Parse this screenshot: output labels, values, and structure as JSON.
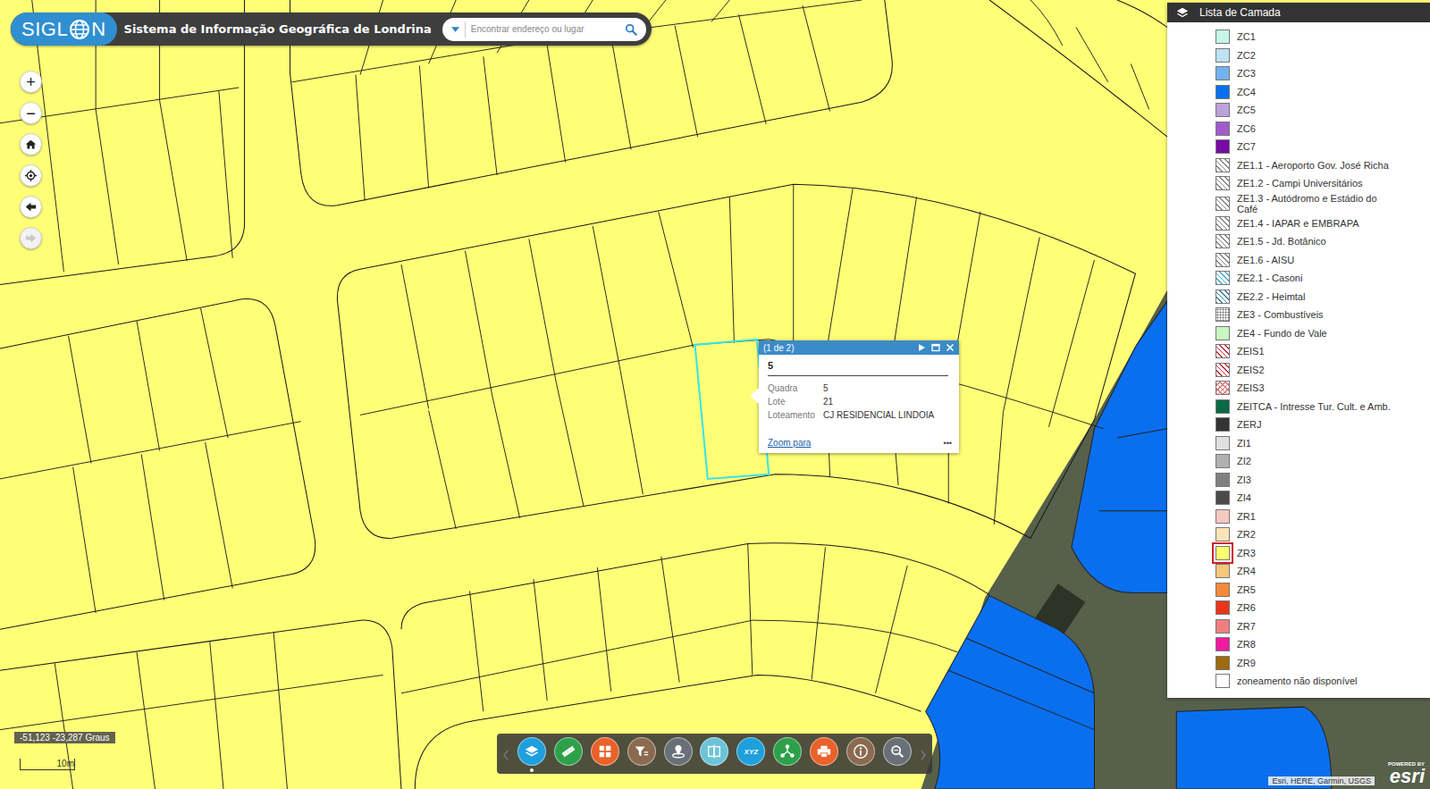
{
  "header": {
    "logo_left": "SIGL",
    "logo_right": "N",
    "title": "Sistema de Informação Geográfica de Londrina"
  },
  "search": {
    "placeholder": "Encontrar endereço ou lugar"
  },
  "map_controls": [
    {
      "kind": "zoom-in",
      "label": "+",
      "disabled": false
    },
    {
      "kind": "zoom-out",
      "label": "−",
      "disabled": false
    },
    {
      "kind": "home",
      "disabled": false
    },
    {
      "kind": "locate",
      "disabled": false
    },
    {
      "kind": "back",
      "disabled": false
    },
    {
      "kind": "forward",
      "disabled": true
    }
  ],
  "popup": {
    "counter": "(1 de 2)",
    "title": "5",
    "fields": [
      {
        "label": "Quadra",
        "value": "5"
      },
      {
        "label": "Lote",
        "value": "21"
      },
      {
        "label": "Loteamento",
        "value": "CJ RESIDENCIAL LINDOIA"
      }
    ],
    "zoom_link": "Zoom para",
    "more": "•••"
  },
  "layer_panel": {
    "title": "Lista de Camada",
    "items": [
      {
        "name": "ZC1",
        "color": "#c4f7e8",
        "kind": "solid",
        "selected": false
      },
      {
        "name": "ZC2",
        "color": "#bfe2f6",
        "kind": "solid",
        "selected": false
      },
      {
        "name": "ZC3",
        "color": "#74b2ee",
        "kind": "solid",
        "selected": false
      },
      {
        "name": "ZC4",
        "color": "#0a6fef",
        "kind": "solid",
        "selected": false
      },
      {
        "name": "ZC5",
        "color": "#bba2d9",
        "kind": "solid",
        "selected": false
      },
      {
        "name": "ZC6",
        "color": "#a15ccc",
        "kind": "solid",
        "selected": false
      },
      {
        "name": "ZC7",
        "color": "#780aa6",
        "kind": "solid",
        "selected": false
      },
      {
        "name": "ZE1.1 - Aeroporto Gov. José Richa",
        "color": "#888888",
        "kind": "hatch",
        "selected": false
      },
      {
        "name": "ZE1.2 - Campi Universitários",
        "color": "#888888",
        "kind": "hatch",
        "selected": false
      },
      {
        "name": "ZE1.3 - Autódromo e Estádio do Café",
        "color": "#888888",
        "kind": "hatch",
        "selected": false
      },
      {
        "name": "ZE1.4 - IAPAR e EMBRAPA",
        "color": "#888888",
        "kind": "hatch",
        "selected": false
      },
      {
        "name": "ZE1.5 - Jd. Botânico",
        "color": "#888888",
        "kind": "hatch",
        "selected": false
      },
      {
        "name": "ZE1.6 - AISU",
        "color": "#888888",
        "kind": "hatch",
        "selected": false
      },
      {
        "name": "ZE2.1 - Casoni",
        "color": "#4aa8c8",
        "kind": "hatch",
        "selected": false
      },
      {
        "name": "ZE2.2 - Heimtal",
        "color": "#3a7fa0",
        "kind": "hatch",
        "selected": false
      },
      {
        "name": "ZE3 - Combustíveis",
        "color": "#666666",
        "kind": "dots",
        "selected": false
      },
      {
        "name": "ZE4 - Fundo de Vale",
        "color": "#c9f5c0",
        "kind": "solid",
        "selected": false
      },
      {
        "name": "ZEIS1",
        "color": "#c0303a",
        "kind": "hatch",
        "selected": false
      },
      {
        "name": "ZEIS2",
        "color": "#c0303a",
        "kind": "hatch",
        "selected": false
      },
      {
        "name": "ZEIS3",
        "color": "#d77a7a",
        "kind": "cross",
        "selected": false
      },
      {
        "name": "ZEITCA - Intresse Tur. Cult. e Amb.",
        "color": "#0b6a46",
        "kind": "solid",
        "selected": false
      },
      {
        "name": "ZERJ",
        "color": "#333333",
        "kind": "solid",
        "selected": false
      },
      {
        "name": "ZI1",
        "color": "#e0e0e0",
        "kind": "solid",
        "selected": false
      },
      {
        "name": "ZI2",
        "color": "#b0b0b0",
        "kind": "solid",
        "selected": false
      },
      {
        "name": "ZI3",
        "color": "#808080",
        "kind": "solid",
        "selected": false
      },
      {
        "name": "ZI4",
        "color": "#4a4a4a",
        "kind": "solid",
        "selected": false
      },
      {
        "name": "ZR1",
        "color": "#f7c8c0",
        "kind": "solid",
        "selected": false
      },
      {
        "name": "ZR2",
        "color": "#fde4b8",
        "kind": "solid",
        "selected": false
      },
      {
        "name": "ZR3",
        "color": "#ffff70",
        "kind": "solid",
        "selected": true
      },
      {
        "name": "ZR4",
        "color": "#f7c87c",
        "kind": "solid",
        "selected": false
      },
      {
        "name": "ZR5",
        "color": "#f7883a",
        "kind": "solid",
        "selected": false
      },
      {
        "name": "ZR6",
        "color": "#e8361a",
        "kind": "solid",
        "selected": false
      },
      {
        "name": "ZR7",
        "color": "#f07f7f",
        "kind": "solid",
        "selected": false
      },
      {
        "name": "ZR8",
        "color": "#ef1aa0",
        "kind": "solid",
        "selected": false
      },
      {
        "name": "ZR9",
        "color": "#a06a10",
        "kind": "solid",
        "selected": false
      },
      {
        "name": "zoneamento não disponível",
        "color": "#ffffff",
        "kind": "empty",
        "selected": false
      }
    ]
  },
  "coordinates": "-51,123 -23,287 Graus",
  "scale": "10m",
  "toolbar": [
    {
      "kind": "layers",
      "color": "#1ea0dc",
      "selected": true
    },
    {
      "kind": "measure",
      "color": "#2ea04a",
      "selected": false
    },
    {
      "kind": "grid",
      "color": "#e8622a",
      "selected": false
    },
    {
      "kind": "filter",
      "color": "#8b6a50",
      "selected": false
    },
    {
      "kind": "locate",
      "color": "#6a7078",
      "selected": false
    },
    {
      "kind": "compare",
      "color": "#6cc4d8",
      "selected": false
    },
    {
      "kind": "xyz",
      "color": "#1ea0dc",
      "selected": false,
      "label": "XYZ"
    },
    {
      "kind": "share",
      "color": "#2ea04a",
      "selected": false
    },
    {
      "kind": "print",
      "color": "#e8622a",
      "selected": false
    },
    {
      "kind": "info",
      "color": "#8b6a50",
      "selected": false
    },
    {
      "kind": "search",
      "color": "#6a7078",
      "selected": false
    }
  ],
  "attribution": "Esri, HERE, Garmin, USGS",
  "esri": {
    "powered": "POWERED BY",
    "name": "esri"
  }
}
